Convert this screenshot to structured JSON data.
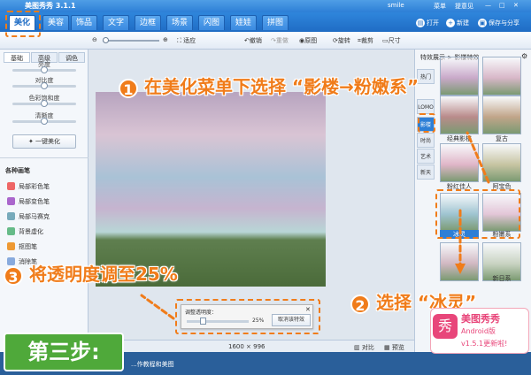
{
  "app": {
    "title": "美图秀秀 3.1.1",
    "user": "smile",
    "menu": "菜单",
    "feedback": "提意见"
  },
  "tabs": [
    "美化",
    "美容",
    "饰品",
    "文字",
    "边框",
    "场景",
    "闪图",
    "娃娃",
    "拼图"
  ],
  "top_buttons": {
    "open": "打开",
    "new": "新建",
    "save_share": "保存与分享"
  },
  "toolbar": {
    "fit": "适应",
    "undo": "撤销",
    "redo": "重做",
    "original": "原图",
    "rotate": "旋转",
    "crop": "裁剪",
    "size": "尺寸"
  },
  "left_panel": {
    "subtabs": [
      "基础",
      "高级",
      "调色"
    ],
    "sliders": [
      {
        "label": "亮度",
        "value": 0.5
      },
      {
        "label": "对比度",
        "value": 0.5
      },
      {
        "label": "色彩饱和度",
        "value": 0.5
      },
      {
        "label": "清晰度",
        "value": 0.5
      }
    ],
    "auto_button": "一键美化",
    "brushes_title": "各种画笔",
    "brushes": [
      {
        "label": "局部彩色笔",
        "color": "#e66"
      },
      {
        "label": "局部变色笔",
        "color": "#a6c"
      },
      {
        "label": "局部马赛克",
        "color": "#7ab"
      },
      {
        "label": "背景虚化",
        "color": "#6b8"
      },
      {
        "label": "抠图笔",
        "color": "#e93"
      },
      {
        "label": "消除笔",
        "color": "#8ad"
      }
    ]
  },
  "right_panel": {
    "breadcrumb": "特效展示 > 影楼特效",
    "categories": [
      "热门",
      "LOMO",
      "影楼",
      "时尚",
      "艺术",
      "新天"
    ],
    "selected_category": "影楼",
    "thumbs": [
      {
        "label": "",
        "color": "#c9a9c9"
      },
      {
        "label": "",
        "color": "#d8b7c8"
      },
      {
        "label": "经典影楼",
        "color": "#b98b8b"
      },
      {
        "label": "复古",
        "color": "#c1a58a"
      },
      {
        "label": "粉红佳人",
        "color": "#e0b6c8"
      },
      {
        "label": "阿宝色",
        "color": "#c7c4a2"
      },
      {
        "label": "冰灵",
        "color": "#9fc4d1"
      },
      {
        "label": "粉嫩系",
        "color": "#e3c6d8"
      },
      {
        "label": "",
        "color": "#d1b8c2"
      },
      {
        "label": "新日系",
        "color": "#c9d3c2"
      }
    ]
  },
  "status": {
    "dimensions": "1600 × 996",
    "compare": "对比",
    "preview": "预览"
  },
  "dialog": {
    "title": "调整透明度：",
    "value": "25%",
    "button": "取消该特效",
    "opacity": 0.25
  },
  "bottom": {
    "text": "...作教程和美图"
  },
  "annotations": {
    "step1": "在美化菜单下选择 “影楼→粉嫩系”",
    "step2": "选择 “冰灵”",
    "step3": "将透明度调至25%",
    "step_label": "第三步:",
    "n1": "1",
    "n2": "2",
    "n3": "3"
  },
  "promo": {
    "brand": "美图秀秀",
    "platform": "Android版",
    "version": "v1.5.1更新啦!"
  }
}
